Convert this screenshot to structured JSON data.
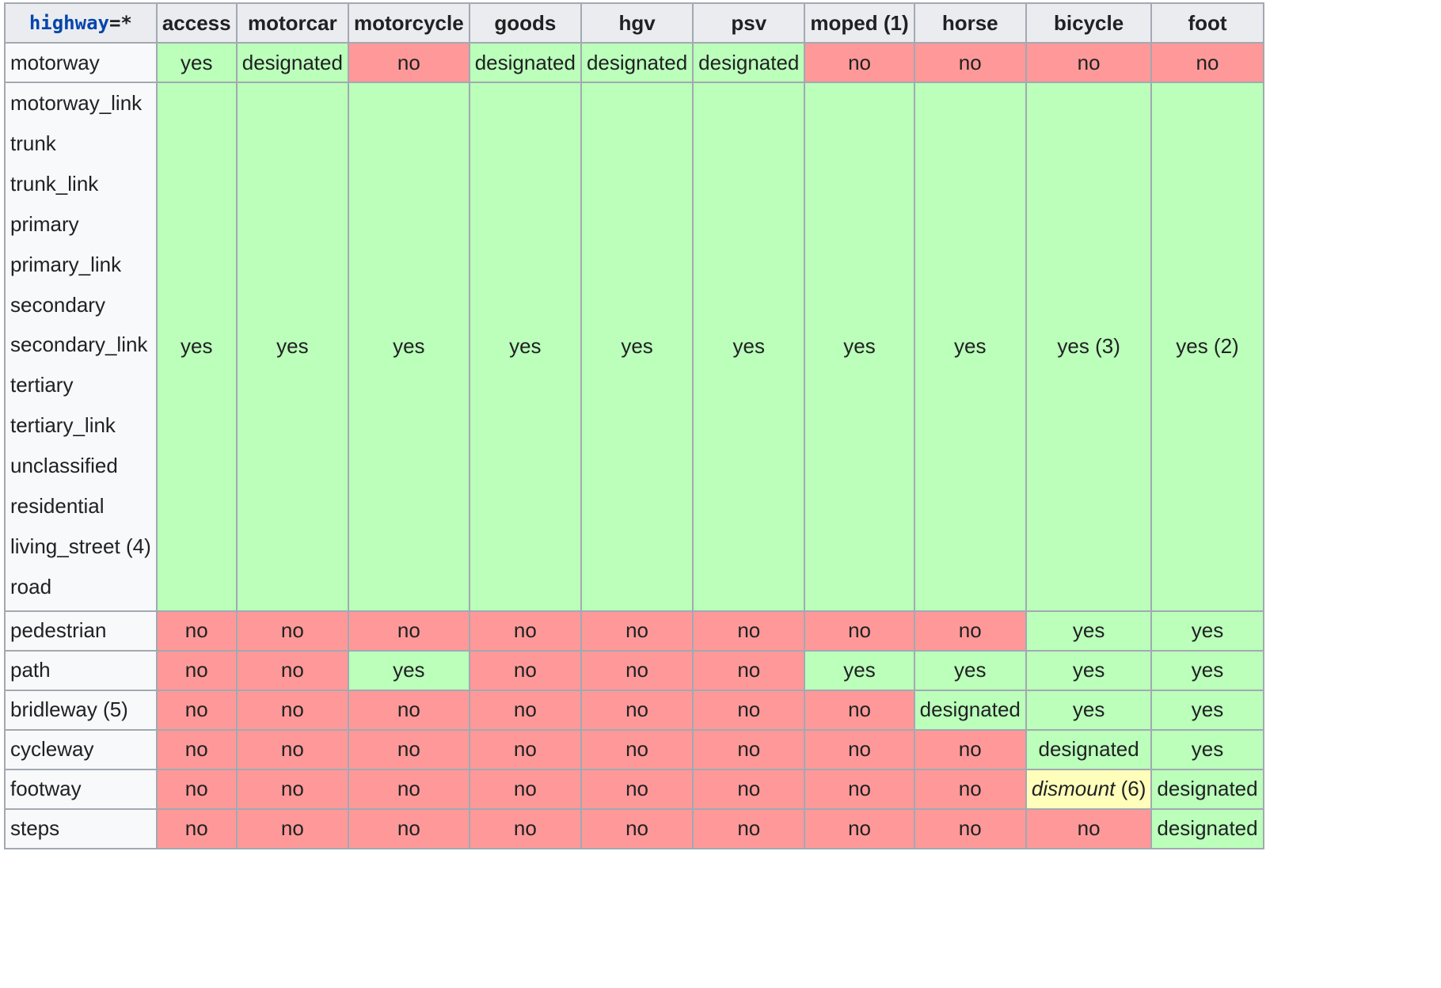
{
  "table": {
    "key_header": {
      "key": "highway",
      "suffix": "=*"
    },
    "columns": [
      "access",
      "motorcar",
      "motorcycle",
      "goods",
      "hgv",
      "psv",
      "moped (1)",
      "horse",
      "bicycle",
      "foot"
    ],
    "group": {
      "labels": [
        "motorway_link",
        "trunk",
        "trunk_link",
        "primary",
        "primary_link",
        "secondary",
        "secondary_link",
        "tertiary",
        "tertiary_link",
        "unclassified",
        "residential",
        "living_street (4)",
        "road"
      ],
      "values": [
        "yes",
        "yes",
        "yes",
        "yes",
        "yes",
        "yes",
        "yes",
        "yes",
        "yes (3)",
        "yes (2)"
      ]
    },
    "rows": [
      {
        "label": "motorway",
        "values": [
          "yes",
          "designated",
          "no",
          "designated",
          "designated",
          "designated",
          "no",
          "no",
          "no",
          "no"
        ]
      },
      {
        "label": "pedestrian",
        "values": [
          "no",
          "no",
          "no",
          "no",
          "no",
          "no",
          "no",
          "no",
          "yes",
          "yes"
        ]
      },
      {
        "label": "path",
        "values": [
          "no",
          "no",
          "yes",
          "no",
          "no",
          "no",
          "yes",
          "yes",
          "yes",
          "yes"
        ]
      },
      {
        "label": "bridleway (5)",
        "values": [
          "no",
          "no",
          "no",
          "no",
          "no",
          "no",
          "no",
          "designated",
          "yes",
          "yes"
        ]
      },
      {
        "label": "cycleway",
        "values": [
          "no",
          "no",
          "no",
          "no",
          "no",
          "no",
          "no",
          "no",
          "designated",
          "yes"
        ]
      },
      {
        "label": "footway",
        "values": [
          "no",
          "no",
          "no",
          "no",
          "no",
          "no",
          "no",
          "no",
          "dismount (6)",
          "designated"
        ]
      },
      {
        "label": "steps",
        "values": [
          "no",
          "no",
          "no",
          "no",
          "no",
          "no",
          "no",
          "no",
          "no",
          "designated"
        ]
      }
    ]
  },
  "colors": {
    "yes": "#bbffbb",
    "designated": "#bbffbb",
    "no": "#ff9999",
    "dismount": "#ffffbb",
    "header_bg": "#eaecf0",
    "label_bg": "#f8f9fa",
    "border": "#a2a9b1",
    "key_link": "#0645ad"
  }
}
